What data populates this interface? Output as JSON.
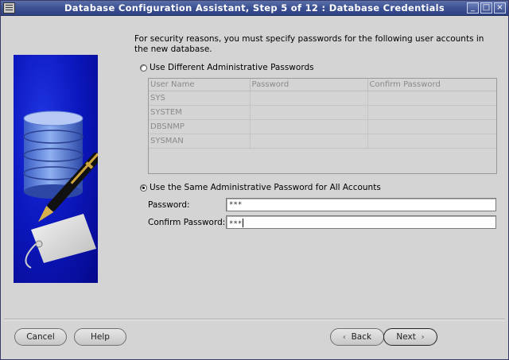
{
  "window": {
    "title": "Database Configuration Assistant, Step 5 of 12 : Database Credentials"
  },
  "title_buttons": {
    "minimize": "_",
    "maximize": "□",
    "close": "×"
  },
  "intro_text": "For security reasons, you must specify passwords for the following user accounts in the new database.",
  "option_different": {
    "label": "Use Different Administrative Passwords",
    "selected": false
  },
  "accounts_table": {
    "headers": [
      "User Name",
      "Password",
      "Confirm Password"
    ],
    "rows": [
      [
        "SYS",
        "",
        ""
      ],
      [
        "SYSTEM",
        "",
        ""
      ],
      [
        "DBSNMP",
        "",
        ""
      ],
      [
        "SYSMAN",
        "",
        ""
      ]
    ]
  },
  "option_same": {
    "label": "Use the Same Administrative Password for All Accounts",
    "selected": true
  },
  "password": {
    "label": "Password:",
    "value": "***"
  },
  "confirm_password": {
    "label": "Confirm Password:",
    "value": "***"
  },
  "buttons": {
    "cancel": "Cancel",
    "help": "Help",
    "back": "Back",
    "next": "Next"
  },
  "colors": {
    "title_bar": "#3c5192",
    "banner": "#0c18c0",
    "window_bg": "#d4d4d4"
  }
}
